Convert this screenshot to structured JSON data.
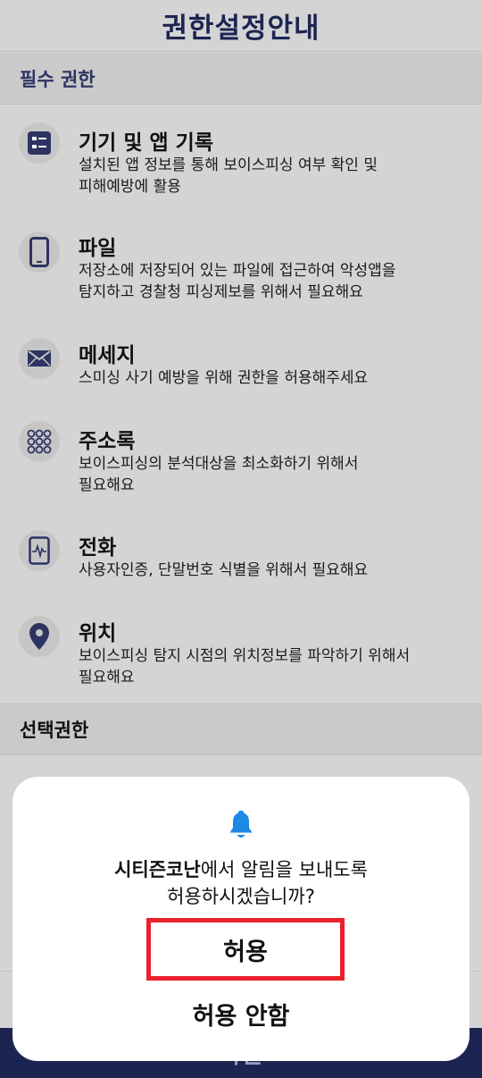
{
  "header": {
    "title": "권한설정안내"
  },
  "sections": {
    "required": "필수 권한",
    "optional": "선택권한"
  },
  "permissions": [
    {
      "icon": "list-icon",
      "title": "기기 및 앱 기록",
      "desc": "설치된 앱 정보를 통해 보이스피싱 여부 확인 및\n피해예방에 활용"
    },
    {
      "icon": "phone-icon",
      "title": "파일",
      "desc": "저장소에 저장되어 있는 파일에 접근하여 악성앱을\n탐지하고 경찰청 피싱제보를 위해서 필요해요"
    },
    {
      "icon": "envelope-icon",
      "title": "메세지",
      "desc": "스미싱 사기 예방을 위해 권한을 허용해주세요"
    },
    {
      "icon": "dialpad-icon",
      "title": "주소록",
      "desc": "보이스피싱의 분석대상을 최소화하기 위해서\n필요해요"
    },
    {
      "icon": "call-wave-icon",
      "title": "전화",
      "desc": "사용자인증, 단말번호 식별을 위해서 필요해요"
    },
    {
      "icon": "location-pin-icon",
      "title": "위치",
      "desc": "보이스피싱 탐지 시점의 위치정보를 파악하기 위해서\n필요해요"
    }
  ],
  "bottom_bar": {
    "label": "확인"
  },
  "dialog": {
    "icon": "bell-icon",
    "app_name": "시티즌코난",
    "message_rest": "에서 알림을 보내도록",
    "message_line2": "허용하시겠습니까?",
    "allow_label": "허용",
    "deny_label": "허용 안함"
  },
  "colors": {
    "navy": "#1c2552",
    "highlight_red": "#e8212b",
    "dim_background": "#d4d4d4"
  }
}
